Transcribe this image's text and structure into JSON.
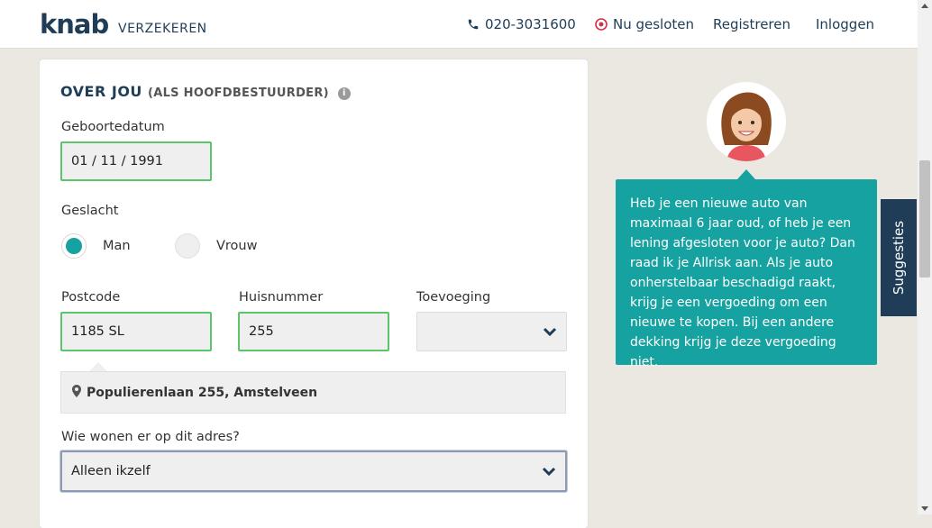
{
  "header": {
    "logo": "knab",
    "logo_sub": "VERZEKEREN",
    "phone": "020-3031600",
    "status": "Nu gesloten",
    "register": "Registreren",
    "login": "Inloggen"
  },
  "form": {
    "title": "OVER JOU",
    "title_sub": "(ALS HOOFDBESTUURDER)",
    "dob_label": "Geboortedatum",
    "dob_value": "01 / 11 / 1991",
    "gender_label": "Geslacht",
    "gender_options": [
      "Man",
      "Vrouw"
    ],
    "gender_selected": "Man",
    "postcode_label": "Postcode",
    "postcode_value": "1185 SL",
    "housenumber_label": "Huisnummer",
    "housenumber_value": "255",
    "suffix_label": "Toevoeging",
    "suffix_value": "",
    "address": "Populierenlaan 255, Amstelveen",
    "residents_label": "Wie wonen er op dit adres?",
    "residents_value": "Alleen ikzelf"
  },
  "advisor": {
    "message": "Heb je een nieuwe auto van maximaal 6 jaar oud, of heb je een lening afgesloten voor je auto? Dan raad ik je Allrisk aan. Als je auto onherstelbaar beschadigd raakt, krijg je een vergoeding om een nieuwe te kopen. Bij een andere dekking krijg je deze vergoeding niet."
  },
  "suggestions_tab": "Suggesties",
  "colors": {
    "brand": "#1f3d57",
    "accent": "#16a2a0",
    "valid": "#5cc46c",
    "status": "#d0304a"
  }
}
